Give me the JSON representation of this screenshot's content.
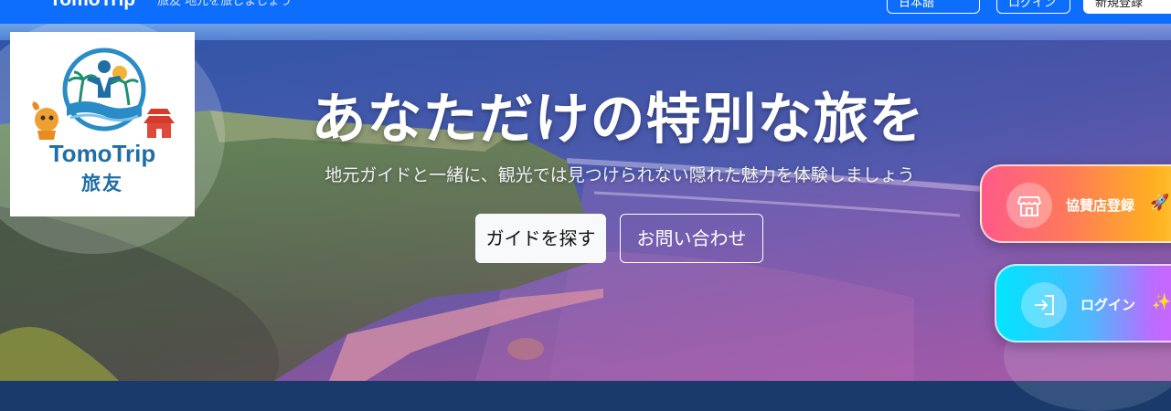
{
  "navbar": {
    "brand": "TomoTrip",
    "tagline": "旅友 地元を旅しましょう",
    "language_label": "日本語",
    "login_label": "ログイン",
    "signup_label": "新規登録"
  },
  "logo": {
    "name": "TomoTrip",
    "kanji": "旅友"
  },
  "hero": {
    "title": "あなただけの特別な旅を",
    "subtitle": "地元ガイドと一緒に、観光では見つけられない隠れた魅力を体験しましょう",
    "primary_button": "ガイドを探す",
    "secondary_button": "お問い合わせ"
  },
  "floating": {
    "partner_label": "協賛店登録",
    "partner_emoji": "🚀",
    "login_label": "ログイン",
    "login_emoji": "✨"
  },
  "colors": {
    "navbar": "#0d6efd",
    "logo_text": "#1f6fa5"
  },
  "icons": [
    "store-icon",
    "sign-in-icon",
    "palm-tree-icon",
    "shisa-icon",
    "castle-icon"
  ]
}
